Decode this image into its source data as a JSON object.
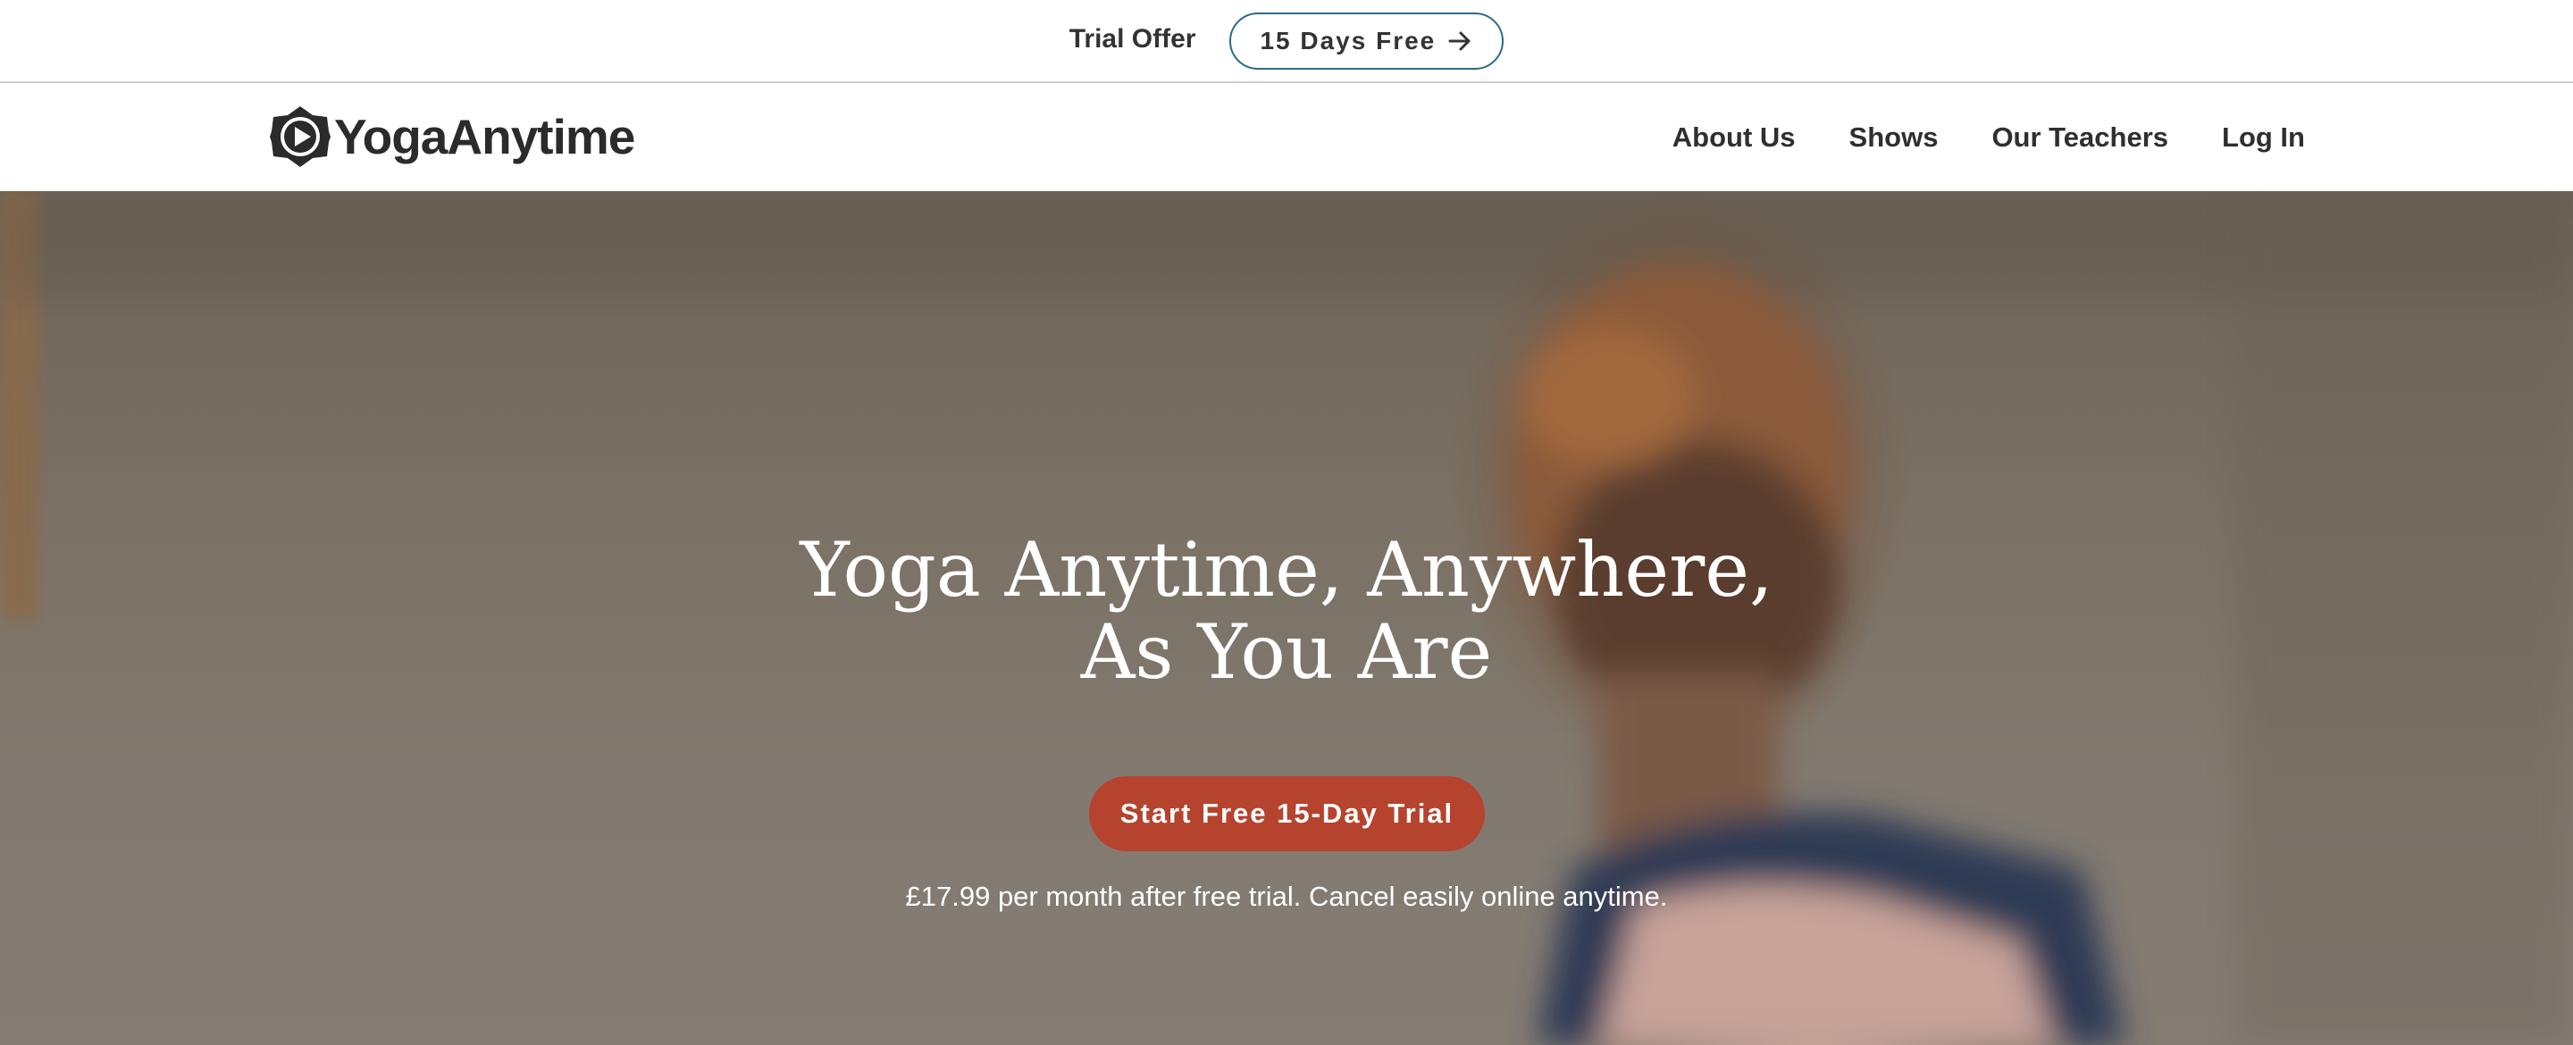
{
  "promo": {
    "text": "Trial Offer",
    "button_label": "15 Days Free",
    "button_icon": "arrow-right-icon",
    "button_border_color": "#2c6b86"
  },
  "header": {
    "logo_text": "YogaAnytime",
    "logo_icon": "play-lotus-icon",
    "nav": [
      {
        "label": "About Us"
      },
      {
        "label": "Shows"
      },
      {
        "label": "Our Teachers"
      },
      {
        "label": "Log In"
      }
    ]
  },
  "hero": {
    "title_line1": "Yoga Anytime, Anywhere,",
    "title_line2": "As You Are",
    "cta_label": "Start Free 15-Day Trial",
    "cta_color": "#b5432d",
    "price_note": "£17.99 per month after free trial. Cancel easily online anytime."
  }
}
